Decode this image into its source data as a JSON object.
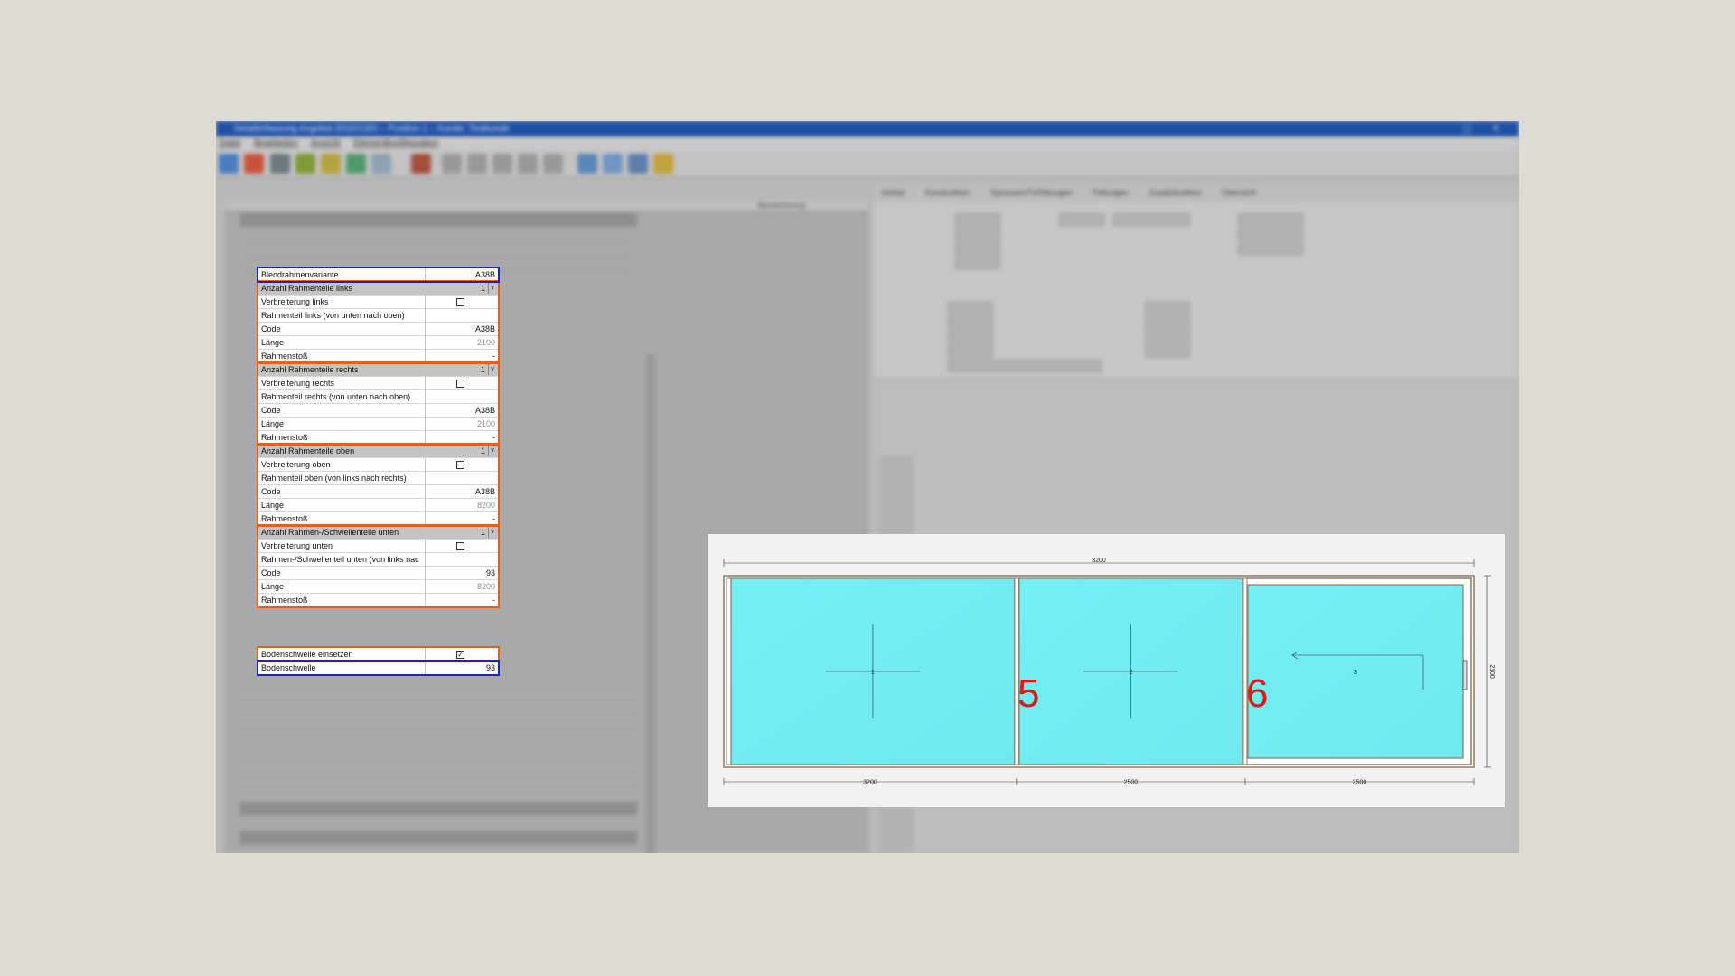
{
  "window": {
    "title": "Detailerfassung Angebot 2010/1320 – Position 1 – Kunde: Testkunde",
    "menu": [
      "Datei",
      "Bearbeiten",
      "Ansicht",
      "Elementkonfiguration"
    ],
    "tabs": [
      "Global",
      "Konstruktion",
      "Sprossen/Türfüllungen",
      "Füllungen",
      "Zusatzfunktion",
      "Übersicht"
    ],
    "column_header": "Bezeichnung"
  },
  "properties": [
    {
      "label": "Blendrahmenvariante",
      "value": "A38B",
      "kind": "value",
      "box": "blue"
    },
    {
      "label": "Anzahl Rahmenteile links",
      "value": "1",
      "kind": "combo",
      "header": true
    },
    {
      "label": "Verbreiterung links",
      "value": "",
      "kind": "check",
      "checked": false
    },
    {
      "label": "Rahmenteil links (von unten nach oben)",
      "value": "",
      "kind": "value"
    },
    {
      "label": "Code",
      "value": "A38B",
      "kind": "value"
    },
    {
      "label": "Länge",
      "value": "2100",
      "kind": "muted"
    },
    {
      "label": "Rahmenstoß",
      "value": "-",
      "kind": "value"
    },
    {
      "label": "Anzahl Rahmenteile rechts",
      "value": "1",
      "kind": "combo",
      "header": true
    },
    {
      "label": "Verbreiterung rechts",
      "value": "",
      "kind": "check",
      "checked": false
    },
    {
      "label": "Rahmenteil rechts (von unten nach oben)",
      "value": "",
      "kind": "value"
    },
    {
      "label": "Code",
      "value": "A38B",
      "kind": "value"
    },
    {
      "label": "Länge",
      "value": "2100",
      "kind": "muted"
    },
    {
      "label": "Rahmenstoß",
      "value": "-",
      "kind": "value"
    },
    {
      "label": "Anzahl Rahmenteile oben",
      "value": "1",
      "kind": "combo",
      "header": true
    },
    {
      "label": "Verbreiterung oben",
      "value": "",
      "kind": "check",
      "checked": false
    },
    {
      "label": "Rahmenteil oben (von links nach rechts)",
      "value": "",
      "kind": "value"
    },
    {
      "label": "Code",
      "value": "A38B",
      "kind": "value"
    },
    {
      "label": "Länge",
      "value": "8200",
      "kind": "muted"
    },
    {
      "label": "Rahmenstoß",
      "value": "-",
      "kind": "value"
    },
    {
      "label": "Anzahl Rahmen-/Schwellenteile unten",
      "value": "1",
      "kind": "combo",
      "header": true
    },
    {
      "label": "Verbreiterung unten",
      "value": "",
      "kind": "check",
      "checked": false
    },
    {
      "label": "Rahmen-/Schwellenteil unten (von links nach r",
      "value": "",
      "kind": "value"
    },
    {
      "label": "Code",
      "value": "93",
      "kind": "value"
    },
    {
      "label": "Länge",
      "value": "8200",
      "kind": "muted"
    },
    {
      "label": "Rahmenstoß",
      "value": "-",
      "kind": "value"
    },
    {
      "label": "Bodenschwelle einsetzen",
      "value": "",
      "kind": "check",
      "checked": true,
      "box": "orange"
    },
    {
      "label": "Bodenschwelle",
      "value": "93",
      "kind": "value",
      "box": "blue"
    }
  ],
  "drawing": {
    "total_width": "8200",
    "height": "2100",
    "segment_widths": [
      "3200",
      "2500",
      "2500"
    ],
    "panel_numbers": [
      "1",
      "2",
      "3"
    ],
    "callouts": [
      "5",
      "6"
    ],
    "glass_color": "#6fe9ee",
    "frame_color": "#8a7a5e"
  },
  "colors": {
    "highlight_blue": "#1a24b8",
    "highlight_orange": "#e4611a",
    "titlebar": "#1c4fa6"
  }
}
